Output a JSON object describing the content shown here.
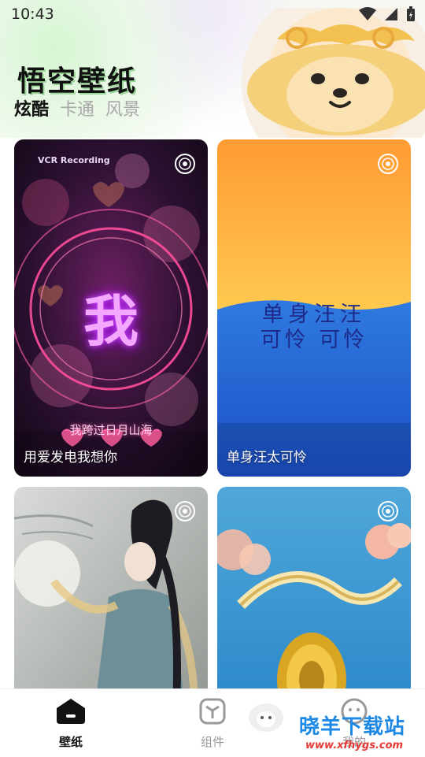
{
  "status_bar": {
    "time": "10:43"
  },
  "header": {
    "title": "悟空壁纸"
  },
  "tabs": [
    {
      "label": "炫酷",
      "active": true
    },
    {
      "label": "卡通",
      "active": false
    },
    {
      "label": "风景",
      "active": false
    }
  ],
  "cards": [
    {
      "caption": "用爱发电我想你",
      "overlay_tag": "VCR Recording",
      "center_char": "我",
      "bottom_text": "我跨过日月山海"
    },
    {
      "caption": "单身汪太可怜",
      "line1": "单身汪汪",
      "line2": "可怜 可怜"
    },
    {
      "caption": ""
    },
    {
      "caption": ""
    }
  ],
  "bottom_nav": [
    {
      "label": "壁纸",
      "icon": "wallpaper-icon",
      "active": true
    },
    {
      "label": "组件",
      "icon": "widget-icon",
      "active": false
    },
    {
      "label": "我的",
      "icon": "profile-icon",
      "active": false
    }
  ],
  "watermark": {
    "name": "晓羊下载站",
    "url": "www.xfhygs.com"
  },
  "colors": {
    "accent_green": "#7fd67a",
    "watermark_blue": "#1e88e5",
    "watermark_red": "#e53935"
  }
}
